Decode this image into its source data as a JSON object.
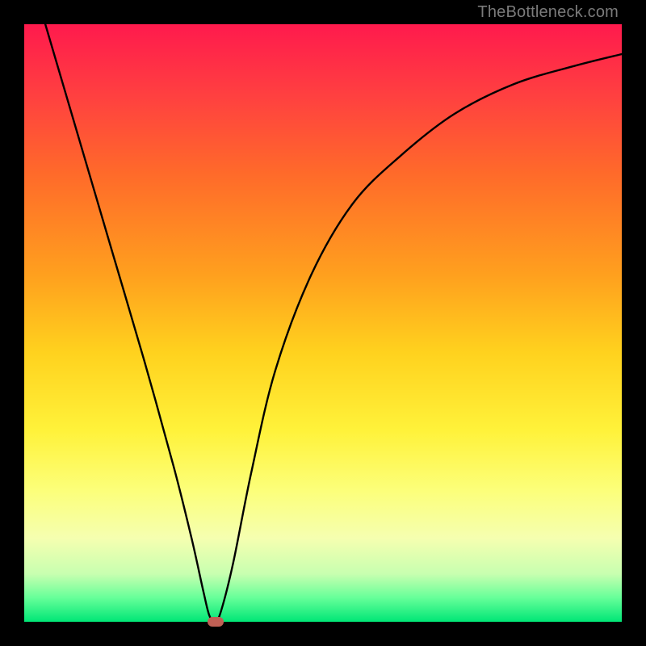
{
  "watermark": "TheBottleneck.com",
  "colors": {
    "frame": "#000000",
    "curve": "#000000",
    "marker": "#c06055"
  },
  "chart_data": {
    "type": "line",
    "title": "",
    "xlabel": "",
    "ylabel": "",
    "xlim": [
      0,
      100
    ],
    "ylim": [
      0,
      100
    ],
    "grid": false,
    "legend": false,
    "description": "V-shaped bottleneck curve on a vertical red-to-green gradient background; minimum (optimal point) marked by a small rounded rectangle near the bottom.",
    "series": [
      {
        "name": "bottleneck-curve",
        "x": [
          0,
          5,
          10,
          15,
          20,
          25,
          28,
          30,
          31,
          32,
          33,
          35,
          38,
          42,
          48,
          55,
          63,
          72,
          82,
          92,
          100
        ],
        "y": [
          112,
          95,
          78,
          61,
          44,
          26,
          14,
          5,
          1,
          0,
          2,
          10,
          25,
          42,
          58,
          70,
          78,
          85,
          90,
          93,
          95
        ]
      }
    ],
    "marker": {
      "x": 32,
      "y": 0,
      "shape": "rounded-rect"
    }
  }
}
